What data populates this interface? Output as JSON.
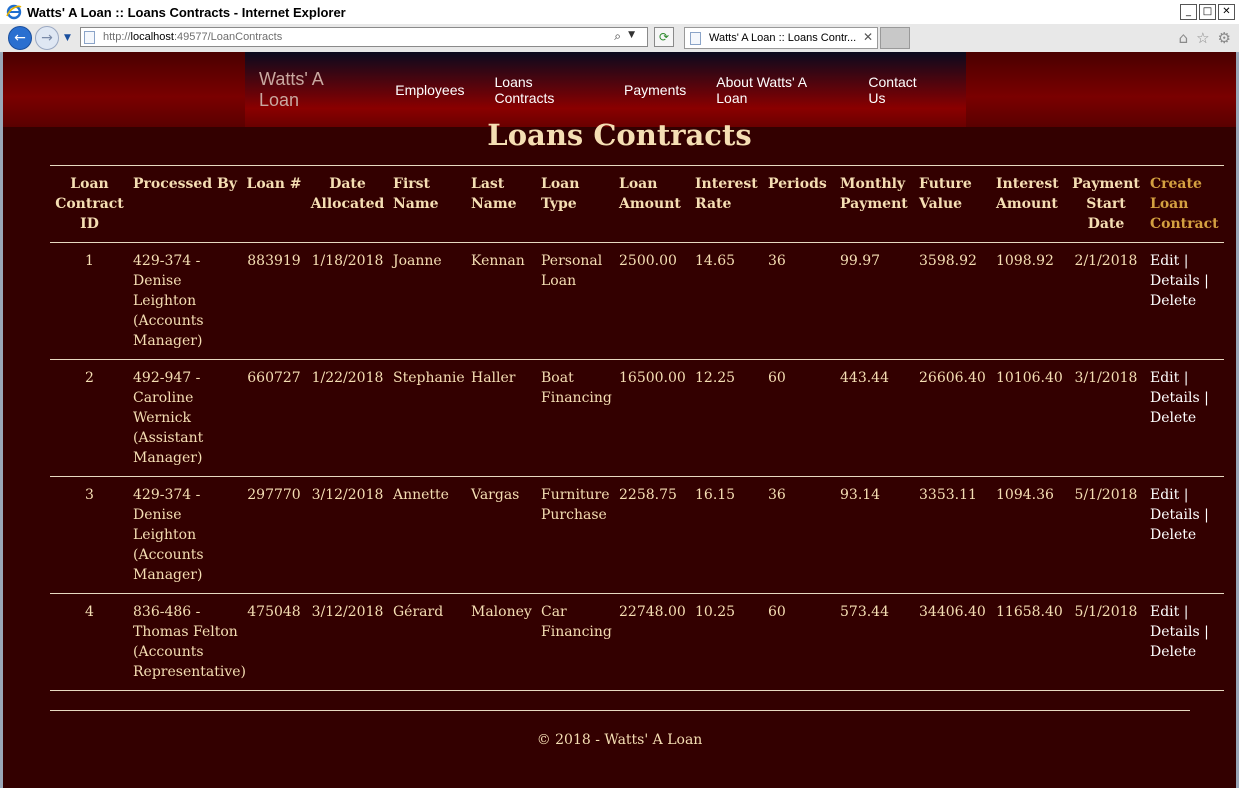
{
  "window": {
    "title": "Watts' A Loan :: Loans Contracts - Internet Explorer",
    "buttons": {
      "minimize": "_",
      "maximize": "□",
      "close": "✕"
    }
  },
  "browser": {
    "url_prefix": "http://",
    "url_host": "localhost",
    "url_rest": ":49577/LoanContracts",
    "tab_label": "Watts' A Loan :: Loans Contr...",
    "tab_close": "✕"
  },
  "site": {
    "brand": "Watts' A Loan",
    "menu": [
      "Employees",
      "Loans Contracts",
      "Payments",
      "About Watts' A Loan",
      "Contact Us"
    ]
  },
  "page": {
    "heading": "Loans Contracts",
    "columns": [
      "Loan Contract ID",
      "Processed By",
      "Loan #",
      "Date Allocated",
      "First Name",
      "Last Name",
      "Loan Type",
      "Loan Amount",
      "Interest Rate",
      "Periods",
      "Monthly Payment",
      "Future Value",
      "Interest Amount",
      "Payment Start Date"
    ],
    "create_link": "Create Loan Contract",
    "action_labels": {
      "edit": "Edit",
      "details": "Details",
      "delete": "Delete",
      "separator": "|"
    },
    "rows": [
      {
        "id": "1",
        "processed_by": "429-374 - Denise Leighton (Accounts Manager)",
        "loan_number": "883919",
        "date_allocated": "1/18/2018",
        "first_name": "Joanne",
        "last_name": "Kennan",
        "loan_type": "Personal Loan",
        "loan_amount": "2500.00",
        "interest_rate": "14.65",
        "periods": "36",
        "monthly_payment": "99.97",
        "future_value": "3598.92",
        "interest_amount": "1098.92",
        "payment_start": "2/1/2018"
      },
      {
        "id": "2",
        "processed_by": "492-947 - Caroline Wernick (Assistant Manager)",
        "loan_number": "660727",
        "date_allocated": "1/22/2018",
        "first_name": "Stephanie",
        "last_name": "Haller",
        "loan_type": "Boat Financing",
        "loan_amount": "16500.00",
        "interest_rate": "12.25",
        "periods": "60",
        "monthly_payment": "443.44",
        "future_value": "26606.40",
        "interest_amount": "10106.40",
        "payment_start": "3/1/2018"
      },
      {
        "id": "3",
        "processed_by": "429-374 - Denise Leighton (Accounts Manager)",
        "loan_number": "297770",
        "date_allocated": "3/12/2018",
        "first_name": "Annette",
        "last_name": "Vargas",
        "loan_type": "Furniture Purchase",
        "loan_amount": "2258.75",
        "interest_rate": "16.15",
        "periods": "36",
        "monthly_payment": "93.14",
        "future_value": "3353.11",
        "interest_amount": "1094.36",
        "payment_start": "5/1/2018"
      },
      {
        "id": "4",
        "processed_by": "836-486 - Thomas Felton (Accounts Representative)",
        "loan_number": "475048",
        "date_allocated": "3/12/2018",
        "first_name": "Gérard",
        "last_name": "Maloney",
        "loan_type": "Car Financing",
        "loan_amount": "22748.00",
        "interest_rate": "10.25",
        "periods": "60",
        "monthly_payment": "573.44",
        "future_value": "34406.40",
        "interest_amount": "11658.40",
        "payment_start": "5/1/2018"
      }
    ],
    "footer": "© 2018 - Watts' A Loan"
  },
  "colors": {
    "page_background": "#330000",
    "text": "#f5deb3",
    "create_link": "#d4a040",
    "action_links": "#ffffff"
  }
}
